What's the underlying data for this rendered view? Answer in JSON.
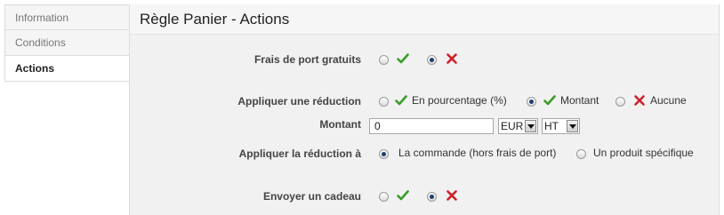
{
  "sidebar": {
    "tabs": [
      {
        "label": "Information"
      },
      {
        "label": "Conditions"
      },
      {
        "label": "Actions"
      }
    ]
  },
  "panel": {
    "title": "Règle Panier - Actions"
  },
  "free_shipping": {
    "label": "Frais de port gratuits",
    "selected": "no"
  },
  "apply_discount": {
    "label": "Appliquer une réduction",
    "options": [
      {
        "label": "En pourcentage (%)"
      },
      {
        "label": "Montant"
      },
      {
        "label": "Aucune"
      }
    ],
    "selected": "Montant"
  },
  "amount": {
    "label": "Montant",
    "value": "0",
    "currency": "EUR",
    "tax": "HT"
  },
  "apply_to": {
    "label": "Appliquer la réduction à",
    "options": [
      {
        "label": "La commande (hors frais de port)"
      },
      {
        "label": "Un produit spécifique"
      }
    ],
    "selected": "La commande (hors frais de port)"
  },
  "gift": {
    "label": "Envoyer un cadeau",
    "selected": "no"
  },
  "colors": {
    "check": "#3a9c2a",
    "cross": "#d0202a"
  }
}
